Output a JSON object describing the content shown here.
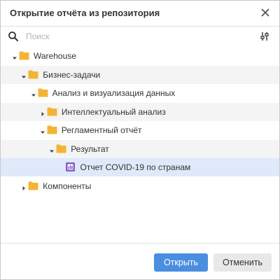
{
  "dialog": {
    "title": "Открытие отчёта из репозитория"
  },
  "search": {
    "placeholder": "Поиск",
    "value": ""
  },
  "tree": {
    "items": [
      {
        "label": "Warehouse",
        "level": 0,
        "expanded": true,
        "type": "folder",
        "shaded": false
      },
      {
        "label": "Бизнес-задачи",
        "level": 1,
        "expanded": true,
        "type": "folder",
        "shaded": true
      },
      {
        "label": "Анализ и визуализация данных",
        "level": 2,
        "expanded": true,
        "type": "folder",
        "shaded": false
      },
      {
        "label": "Интеллектуальный анализ",
        "level": 3,
        "expanded": false,
        "type": "folder",
        "shaded": true
      },
      {
        "label": "Регламентный отчёт",
        "level": 3,
        "expanded": true,
        "type": "folder",
        "shaded": false
      },
      {
        "label": "Результат",
        "level": 4,
        "expanded": true,
        "type": "folder",
        "shaded": true
      },
      {
        "label": "Отчет COVID-19 по странам",
        "level": 5,
        "expanded": null,
        "type": "report",
        "selected": true
      },
      {
        "label": "Компоненты",
        "level": 1,
        "expanded": false,
        "type": "folder",
        "shaded": false
      }
    ]
  },
  "footer": {
    "open_label": "Открыть",
    "cancel_label": "Отменить"
  },
  "colors": {
    "accent": "#4a8ee0",
    "folder": "#f5b335",
    "report_icon": "#8a5bd0",
    "selected_row": "#dfe9f9"
  },
  "icons": {
    "close": "close-icon",
    "search": "search-icon",
    "filter": "filter-sliders-icon",
    "folder": "folder-icon",
    "report": "report-icon",
    "expand": "caret-icon"
  }
}
